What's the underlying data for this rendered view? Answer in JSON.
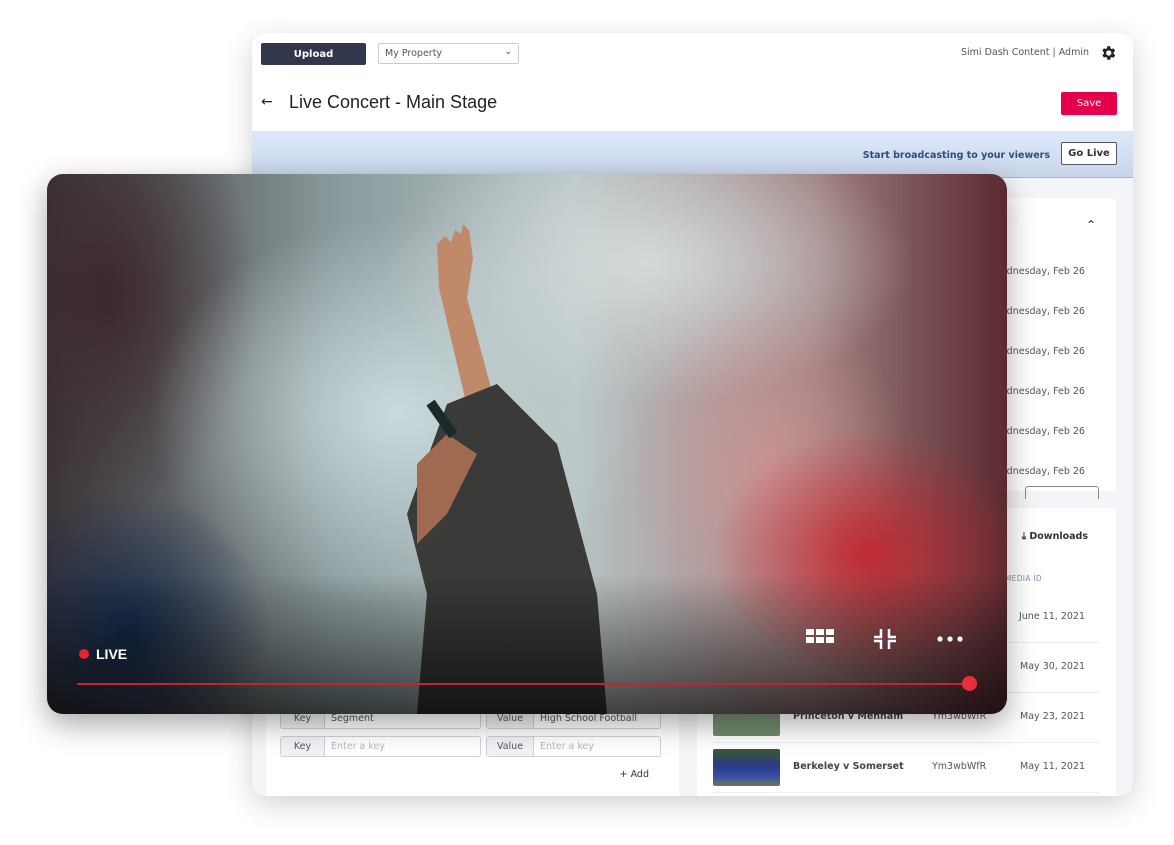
{
  "topbar": {
    "upload_label": "Upload",
    "property_select": "My Property",
    "user_label": "Simi Dash Content | Admin",
    "settings_icon": "gear-icon"
  },
  "header": {
    "back_icon": "arrow-left-icon",
    "title": "Live Concert - Main Stage",
    "save_label": "Save"
  },
  "live_banner": {
    "text": "Start broadcasting to your viewers",
    "go_live_label": "Go Live"
  },
  "schedule": {
    "collapse_icon": "chevron-up-icon",
    "rows": [
      "Wednesday, Feb 26",
      "Wednesday, Feb 26",
      "Wednesday, Feb 26",
      "Wednesday, Feb 26",
      "Wednesday, Feb 26",
      "Wednesday, Feb 26"
    ]
  },
  "media": {
    "downloads_label": "Downloads",
    "column_media_id": "MEDIA ID",
    "rows": [
      {
        "name": "",
        "media_id": "",
        "date": "June 11, 2021"
      },
      {
        "name": "",
        "media_id": "",
        "date": "May 30, 2021"
      },
      {
        "name": "Princeton v Menham",
        "media_id": "Ym3wbWfR",
        "date": "May 23, 2021"
      },
      {
        "name": "Berkeley v Somerset",
        "media_id": "Ym3wbWfR",
        "date": "May 11, 2021"
      }
    ]
  },
  "metadata": {
    "rows": [
      {
        "key_label": "Key",
        "key_value": "Segment",
        "value_label": "Value",
        "value_value": "High School Football"
      },
      {
        "key_label": "Key",
        "key_placeholder": "Enter a key",
        "value_label": "Value",
        "value_placeholder": "Enter a key"
      }
    ],
    "add_label": "Add"
  },
  "player": {
    "live_label": "LIVE",
    "progress": 1.0,
    "controls": [
      "grid-icon",
      "exit-fullscreen-icon",
      "more-icon"
    ],
    "accent": "#e8303a"
  }
}
